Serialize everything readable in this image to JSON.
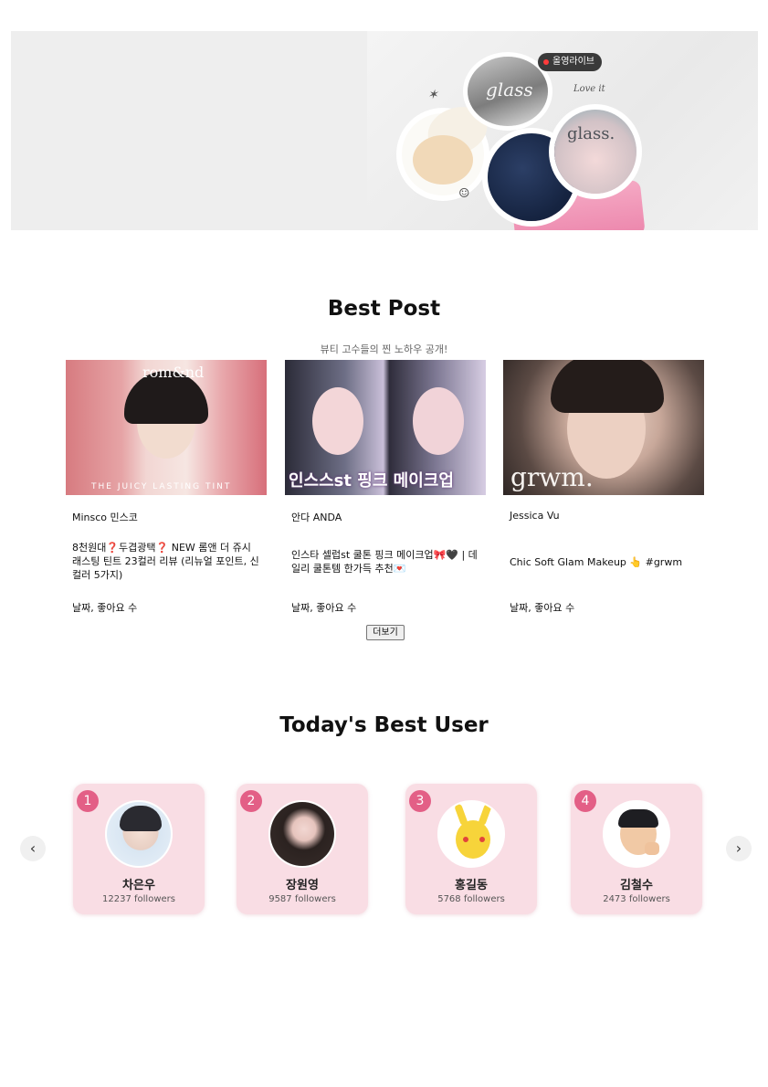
{
  "banner": {
    "live_badge": "올영라이브",
    "product_label_1": "glass",
    "product_label_2": "glass.",
    "scribble": "Love it"
  },
  "best_post": {
    "title": "Best Post",
    "subtitle": "뷰티 고수들의 찐 노하우 공개!",
    "posts": [
      {
        "author": "Minsco 민스코",
        "text": "8천원대❓두겹광택❓ NEW 롬앤 더 쥬시 래스팅 틴트 23컬러 리뷰 (리뉴얼 포인트, 신컬러 5가지)",
        "meta": "날짜, 좋아요 수",
        "thumb_caption_top": "rom&nd",
        "thumb_caption_bottom": "THE JUICY LASTING TINT"
      },
      {
        "author": "안다 ANDA",
        "text": "인스타 셀럽st 쿨톤 핑크 메이크업🎀🖤 | 데일리 쿨톤템 한가득 추천💌",
        "meta": "날짜, 좋아요 수",
        "thumb_caption_bottom": "인스스st 핑크 메이크업"
      },
      {
        "author": "Jessica Vu",
        "text": "Chic Soft Glam Makeup 👆 #grwm",
        "meta": "날짜, 좋아요 수",
        "thumb_caption_bottom": "grwm."
      }
    ],
    "more_button": "더보기"
  },
  "best_user": {
    "title": "Today's Best User",
    "prev_icon": "‹",
    "next_icon": "›",
    "users": [
      {
        "rank": "1",
        "name": "차은우",
        "followers": "12237 followers"
      },
      {
        "rank": "2",
        "name": "장원영",
        "followers": "9587 followers"
      },
      {
        "rank": "3",
        "name": "홍길동",
        "followers": "5768 followers"
      },
      {
        "rank": "4",
        "name": "김철수",
        "followers": "2473 followers"
      }
    ]
  },
  "colors": {
    "card_bg": "#f9dde4",
    "rank_badge": "#e35f86"
  }
}
